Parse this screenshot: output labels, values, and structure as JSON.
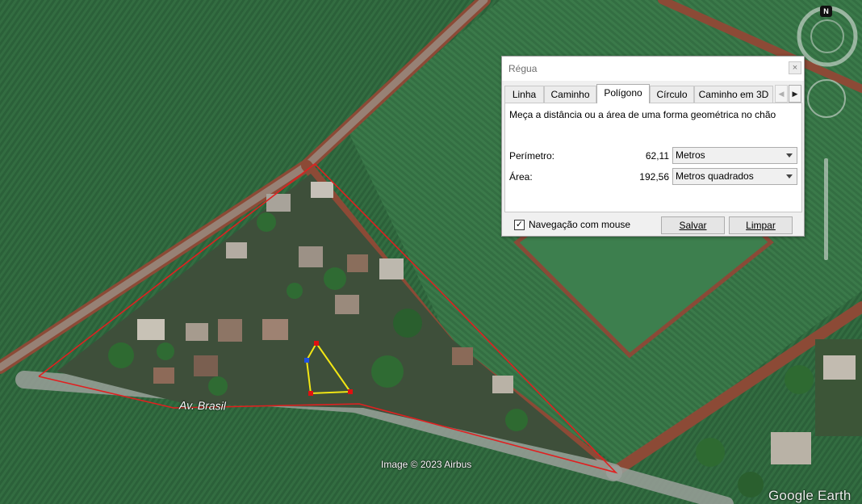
{
  "map": {
    "street_label": "Av. Brasil",
    "attribution": "Image © 2023 Airbus",
    "logo_text": "Google Earth",
    "compass_label": "N"
  },
  "ruler": {
    "title": "Régua",
    "close_label": "×",
    "tabs": [
      {
        "label": "Linha",
        "active": false
      },
      {
        "label": "Caminho",
        "active": false
      },
      {
        "label": "Polígono",
        "active": true
      },
      {
        "label": "Círculo",
        "active": false
      },
      {
        "label": "Caminho em 3D",
        "active": false
      }
    ],
    "description": "Meça a distância ou a área de uma forma geométrica no chão",
    "perimeter": {
      "label": "Perímetro:",
      "value": "62,11",
      "unit": "Metros"
    },
    "area": {
      "label": "Área:",
      "value": "192,56",
      "unit": "Metros quadrados"
    },
    "mouse_navigation": {
      "label": "Navegação com mouse",
      "checked": true,
      "check_mark": "✓"
    },
    "save_label": "Salvar",
    "clear_label": "Limpar"
  },
  "colors": {
    "field": "#2f6a3e",
    "dirt_road": "#8c4a36",
    "block_outline": "#e02020",
    "measured_polygon": "#f2e614",
    "vertex": "#e01010"
  }
}
